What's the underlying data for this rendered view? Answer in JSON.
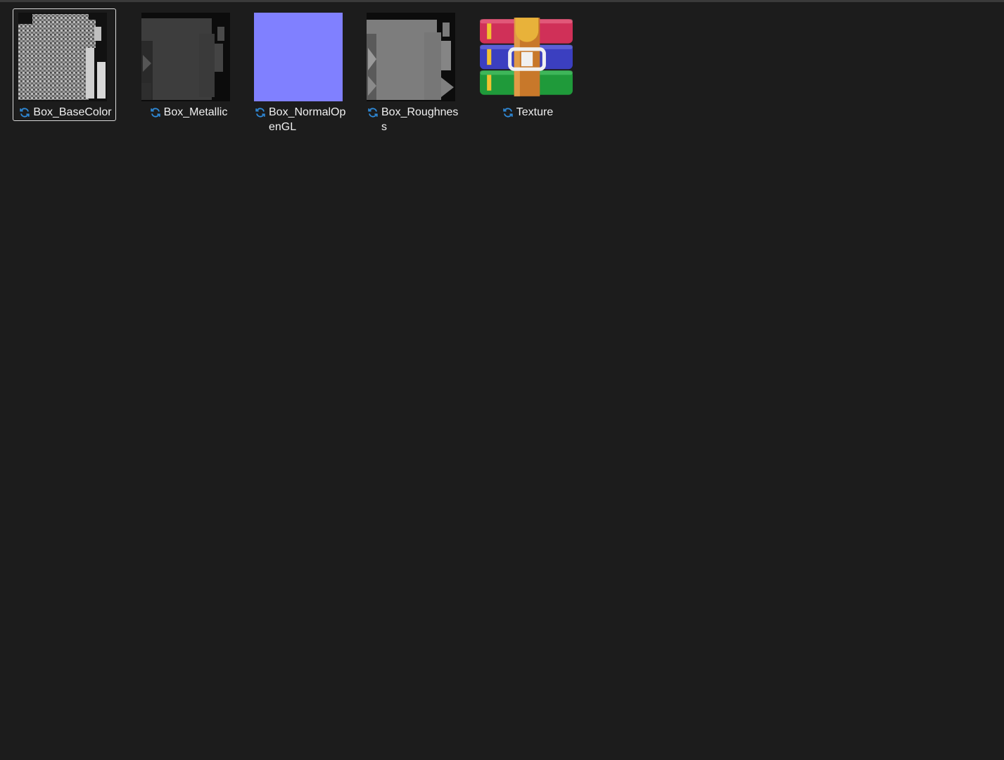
{
  "files": [
    {
      "name": "Box_BaseColor",
      "selected": true,
      "thumb": "basecolor-map",
      "status_icon": "sync-icon"
    },
    {
      "name": "Box_Metallic",
      "selected": false,
      "thumb": "metallic-map",
      "status_icon": "sync-icon"
    },
    {
      "name": "Box_NormalOpenGL",
      "selected": false,
      "thumb": "normal-map",
      "status_icon": "sync-icon"
    },
    {
      "name": "Box_Roughness",
      "selected": false,
      "thumb": "roughness-map",
      "status_icon": "sync-icon"
    },
    {
      "name": "Texture",
      "selected": false,
      "thumb": "winrar-archive-icon",
      "status_icon": "sync-icon"
    }
  ],
  "colors": {
    "background": "#1c1c1c",
    "text": "#f0f0f0",
    "sync_blue": "#2f8ad9",
    "normal_map": "#8080ff"
  }
}
